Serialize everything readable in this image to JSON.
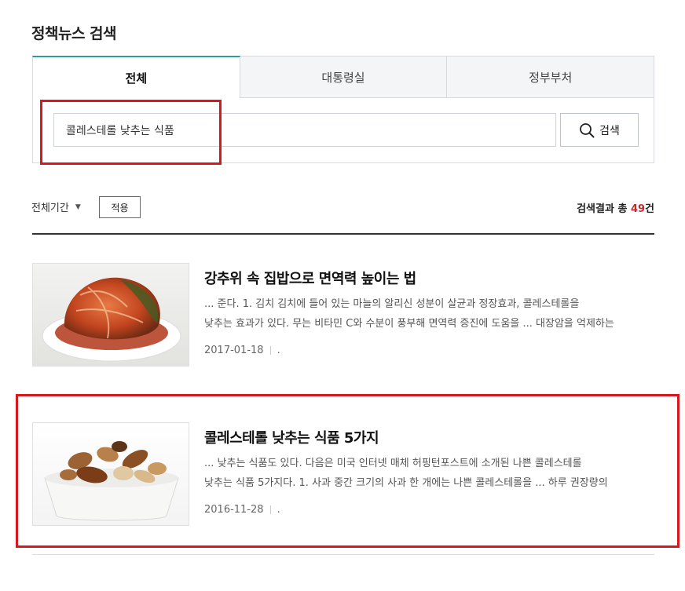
{
  "page": {
    "title": "정책뉴스 검색"
  },
  "tabs": [
    {
      "label": "전체",
      "active": true
    },
    {
      "label": "대통령실",
      "active": false
    },
    {
      "label": "정부부처",
      "active": false
    }
  ],
  "search": {
    "value": "콜레스테롤 낮추는 식품",
    "button_label": "검색"
  },
  "filter": {
    "period_label": "전체기간",
    "apply_label": "적용"
  },
  "results": {
    "prefix": "검색결과 총 ",
    "count": "49",
    "suffix": "건"
  },
  "items": [
    {
      "title": "강추위 속 집밥으로 면역력 높이는 법",
      "desc_line1": "... 준다. 1. 김치 김치에 들어 있는 마늘의 알리신 성분이 살균과 정장효과, 콜레스테롤을",
      "desc_line2": "낮추는 효과가 있다. 무는 비타민 C와 수분이 풍부해 면역력 증진에 도움을 ... 대장암을 억제하는",
      "date": "2017-01-18",
      "source": ".",
      "image": "kimchi-photo"
    },
    {
      "title": "콜레스테롤 낮추는 식품 5가지",
      "desc_line1": "... 낮추는 식품도 있다. 다음은 미국 인터넷 매체 허핑턴포스트에 소개된 나쁜 콜레스테롤",
      "desc_line2": "낮추는 식품 5가지다. 1. 사과 중간 크기의 사과 한 개에는 나쁜 콜레스테롤을 ... 하루 권장량의",
      "date": "2016-11-28",
      "source": ".",
      "image": "nuts-photo"
    }
  ],
  "colors": {
    "accent": "#2e9aa5",
    "highlight": "#d7191f",
    "count": "#c8282d"
  }
}
